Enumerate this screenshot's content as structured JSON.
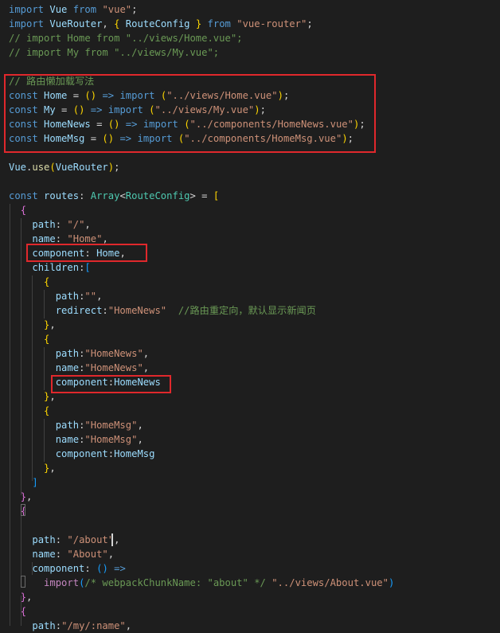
{
  "theme": {
    "background": "#1e1e1e",
    "colors": {
      "kw": "#569cd6",
      "kw2": "#c586c0",
      "var": "#9cdcfe",
      "str": "#ce9178",
      "cm": "#6a9955",
      "type": "#4ec9b0",
      "fn": "#dcdcaa",
      "pun": "#d4d4d4",
      "b1": "#ffd700",
      "b2": "#da70d6",
      "b3": "#179fff",
      "highlight": "#e0282c"
    }
  },
  "editor": {
    "lines": [
      [
        [
          "kw",
          "import"
        ],
        [
          "pun",
          " "
        ],
        [
          "var",
          "Vue"
        ],
        [
          "pun",
          " "
        ],
        [
          "kw",
          "from"
        ],
        [
          "pun",
          " "
        ],
        [
          "str",
          "\"vue\""
        ],
        [
          "pun",
          ";"
        ]
      ],
      [
        [
          "kw",
          "import"
        ],
        [
          "pun",
          " "
        ],
        [
          "var",
          "VueRouter"
        ],
        [
          "pun",
          ", "
        ],
        [
          "b1",
          "{"
        ],
        [
          "pun",
          " "
        ],
        [
          "var",
          "RouteConfig"
        ],
        [
          "pun",
          " "
        ],
        [
          "b1",
          "}"
        ],
        [
          "pun",
          " "
        ],
        [
          "kw",
          "from"
        ],
        [
          "pun",
          " "
        ],
        [
          "str",
          "\"vue-router\""
        ],
        [
          "pun",
          ";"
        ]
      ],
      [
        [
          "cm",
          "// import Home from \"../views/Home.vue\";"
        ]
      ],
      [
        [
          "cm",
          "// import My from \"../views/My.vue\";"
        ]
      ],
      [],
      [
        [
          "cm",
          "// 路由懒加载写法"
        ]
      ],
      [
        [
          "kw",
          "const"
        ],
        [
          "pun",
          " "
        ],
        [
          "var",
          "Home"
        ],
        [
          "pun",
          " = "
        ],
        [
          "b1",
          "("
        ],
        [
          "b1",
          ")"
        ],
        [
          "pun",
          " "
        ],
        [
          "kw",
          "=>"
        ],
        [
          "pun",
          " "
        ],
        [
          "kw",
          "import"
        ],
        [
          "pun",
          " "
        ],
        [
          "b1",
          "("
        ],
        [
          "str",
          "\"../views/Home.vue\""
        ],
        [
          "b1",
          ")"
        ],
        [
          "pun",
          ";"
        ]
      ],
      [
        [
          "kw",
          "const"
        ],
        [
          "pun",
          " "
        ],
        [
          "var",
          "My"
        ],
        [
          "pun",
          " = "
        ],
        [
          "b1",
          "("
        ],
        [
          "b1",
          ")"
        ],
        [
          "pun",
          " "
        ],
        [
          "kw",
          "=>"
        ],
        [
          "pun",
          " "
        ],
        [
          "kw",
          "import"
        ],
        [
          "pun",
          " "
        ],
        [
          "b1",
          "("
        ],
        [
          "str",
          "\"../views/My.vue\""
        ],
        [
          "b1",
          ")"
        ],
        [
          "pun",
          ";"
        ]
      ],
      [
        [
          "kw",
          "const"
        ],
        [
          "pun",
          " "
        ],
        [
          "var",
          "HomeNews"
        ],
        [
          "pun",
          " = "
        ],
        [
          "b1",
          "("
        ],
        [
          "b1",
          ")"
        ],
        [
          "pun",
          " "
        ],
        [
          "kw",
          "=>"
        ],
        [
          "pun",
          " "
        ],
        [
          "kw",
          "import"
        ],
        [
          "pun",
          " "
        ],
        [
          "b1",
          "("
        ],
        [
          "str",
          "\"../components/HomeNews.vue\""
        ],
        [
          "b1",
          ")"
        ],
        [
          "pun",
          ";"
        ]
      ],
      [
        [
          "kw",
          "const"
        ],
        [
          "pun",
          " "
        ],
        [
          "var",
          "HomeMsg"
        ],
        [
          "pun",
          " = "
        ],
        [
          "b1",
          "("
        ],
        [
          "b1",
          ")"
        ],
        [
          "pun",
          " "
        ],
        [
          "kw",
          "=>"
        ],
        [
          "pun",
          " "
        ],
        [
          "kw",
          "import"
        ],
        [
          "pun",
          " "
        ],
        [
          "b1",
          "("
        ],
        [
          "str",
          "\"../components/HomeMsg.vue\""
        ],
        [
          "b1",
          ")"
        ],
        [
          "pun",
          ";"
        ]
      ],
      [],
      [
        [
          "var",
          "Vue"
        ],
        [
          "pun",
          "."
        ],
        [
          "fn",
          "use"
        ],
        [
          "b1",
          "("
        ],
        [
          "var",
          "VueRouter"
        ],
        [
          "b1",
          ")"
        ],
        [
          "pun",
          ";"
        ]
      ],
      [],
      [
        [
          "kw",
          "const"
        ],
        [
          "pun",
          " "
        ],
        [
          "var",
          "routes"
        ],
        [
          "pun",
          ": "
        ],
        [
          "type",
          "Array"
        ],
        [
          "pun",
          "<"
        ],
        [
          "type",
          "RouteConfig"
        ],
        [
          "pun",
          "> = "
        ],
        [
          "b1",
          "["
        ]
      ],
      [
        [
          "pun",
          "  "
        ],
        [
          "b2",
          "{"
        ]
      ],
      [
        [
          "pun",
          "    "
        ],
        [
          "var",
          "path"
        ],
        [
          "pun",
          ": "
        ],
        [
          "str",
          "\"/\""
        ],
        [
          "pun",
          ","
        ]
      ],
      [
        [
          "pun",
          "    "
        ],
        [
          "var",
          "name"
        ],
        [
          "pun",
          ": "
        ],
        [
          "str",
          "\"Home\""
        ],
        [
          "pun",
          ","
        ]
      ],
      [
        [
          "pun",
          "    "
        ],
        [
          "var",
          "component"
        ],
        [
          "pun",
          ": "
        ],
        [
          "var",
          "Home"
        ],
        [
          "pun",
          ","
        ]
      ],
      [
        [
          "pun",
          "    "
        ],
        [
          "var",
          "children"
        ],
        [
          "pun",
          ":"
        ],
        [
          "b3",
          "["
        ]
      ],
      [
        [
          "pun",
          "      "
        ],
        [
          "b1",
          "{"
        ]
      ],
      [
        [
          "pun",
          "        "
        ],
        [
          "var",
          "path"
        ],
        [
          "pun",
          ":"
        ],
        [
          "str",
          "\"\""
        ],
        [
          "pun",
          ","
        ]
      ],
      [
        [
          "pun",
          "        "
        ],
        [
          "var",
          "redirect"
        ],
        [
          "pun",
          ":"
        ],
        [
          "str",
          "\"HomeNews\""
        ],
        [
          "pun",
          "  "
        ],
        [
          "cm",
          "//路由重定向，默认显示新闻页"
        ]
      ],
      [
        [
          "pun",
          "      "
        ],
        [
          "b1",
          "}"
        ],
        [
          "pun",
          ","
        ]
      ],
      [
        [
          "pun",
          "      "
        ],
        [
          "b1",
          "{"
        ]
      ],
      [
        [
          "pun",
          "        "
        ],
        [
          "var",
          "path"
        ],
        [
          "pun",
          ":"
        ],
        [
          "str",
          "\"HomeNews\""
        ],
        [
          "pun",
          ","
        ]
      ],
      [
        [
          "pun",
          "        "
        ],
        [
          "var",
          "name"
        ],
        [
          "pun",
          ":"
        ],
        [
          "str",
          "\"HomeNews\""
        ],
        [
          "pun",
          ","
        ]
      ],
      [
        [
          "pun",
          "        "
        ],
        [
          "var",
          "component"
        ],
        [
          "pun",
          ":"
        ],
        [
          "var",
          "HomeNews"
        ]
      ],
      [
        [
          "pun",
          "      "
        ],
        [
          "b1",
          "}"
        ],
        [
          "pun",
          ","
        ]
      ],
      [
        [
          "pun",
          "      "
        ],
        [
          "b1",
          "{"
        ]
      ],
      [
        [
          "pun",
          "        "
        ],
        [
          "var",
          "path"
        ],
        [
          "pun",
          ":"
        ],
        [
          "str",
          "\"HomeMsg\""
        ],
        [
          "pun",
          ","
        ]
      ],
      [
        [
          "pun",
          "        "
        ],
        [
          "var",
          "name"
        ],
        [
          "pun",
          ":"
        ],
        [
          "str",
          "\"HomeMsg\""
        ],
        [
          "pun",
          ","
        ]
      ],
      [
        [
          "pun",
          "        "
        ],
        [
          "var",
          "component"
        ],
        [
          "pun",
          ":"
        ],
        [
          "var",
          "HomeMsg"
        ]
      ],
      [
        [
          "pun",
          "      "
        ],
        [
          "b1",
          "}"
        ],
        [
          "pun",
          ","
        ]
      ],
      [
        [
          "pun",
          "    "
        ],
        [
          "b3",
          "]"
        ]
      ],
      [
        [
          "pun",
          "  "
        ],
        [
          "b2",
          "}"
        ],
        [
          "pun",
          ","
        ]
      ],
      [
        [
          "pun",
          "  "
        ],
        [
          "b2",
          "{"
        ]
      ],
      [],
      [
        [
          "pun",
          "    "
        ],
        [
          "var",
          "path"
        ],
        [
          "pun",
          ": "
        ],
        [
          "str",
          "\"/about\""
        ],
        [
          "pun",
          ","
        ]
      ],
      [
        [
          "pun",
          "    "
        ],
        [
          "var",
          "name"
        ],
        [
          "pun",
          ": "
        ],
        [
          "str",
          "\"About\""
        ],
        [
          "pun",
          ","
        ]
      ],
      [
        [
          "pun",
          "    "
        ],
        [
          "var",
          "component"
        ],
        [
          "pun",
          ": "
        ],
        [
          "b3",
          "("
        ],
        [
          "b3",
          ")"
        ],
        [
          "pun",
          " "
        ],
        [
          "kw",
          "=>"
        ]
      ],
      [
        [
          "pun",
          "      "
        ],
        [
          "kw2",
          "import"
        ],
        [
          "b3",
          "("
        ],
        [
          "cm",
          "/* webpackChunkName: \"about\" */"
        ],
        [
          "pun",
          " "
        ],
        [
          "str",
          "\"../views/About.vue\""
        ],
        [
          "b3",
          ")"
        ]
      ],
      [
        [
          "pun",
          "  "
        ],
        [
          "b2",
          "}"
        ],
        [
          "pun",
          ","
        ]
      ],
      [
        [
          "pun",
          "  "
        ],
        [
          "b2",
          "{"
        ]
      ],
      [
        [
          "pun",
          "    "
        ],
        [
          "var",
          "path"
        ],
        [
          "pun",
          ":"
        ],
        [
          "str",
          "\"/my/:name\""
        ],
        [
          "pun",
          ","
        ]
      ]
    ]
  }
}
